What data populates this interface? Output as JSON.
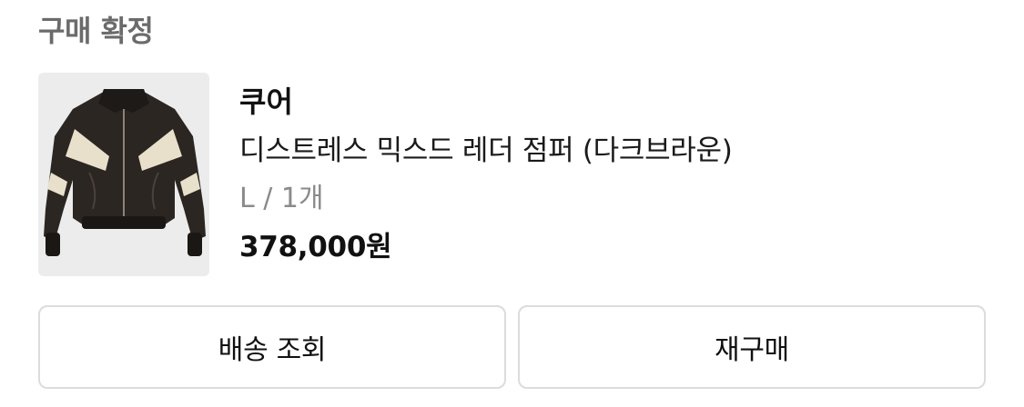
{
  "order": {
    "status": "구매 확정"
  },
  "product": {
    "brand": "쿠어",
    "name": "디스트레스 믹스드 레더 점퍼 (다크브라운)",
    "option": "L / 1개",
    "price": "378,000원",
    "image_icon": "leather-jacket"
  },
  "actions": {
    "track_label": "배송 조회",
    "rebuy_label": "재구매"
  },
  "colors": {
    "status_text": "#6b6b6b",
    "option_text": "#8a8a8a",
    "button_border": "#dcdcdc",
    "thumbnail_bg": "#ececec"
  }
}
